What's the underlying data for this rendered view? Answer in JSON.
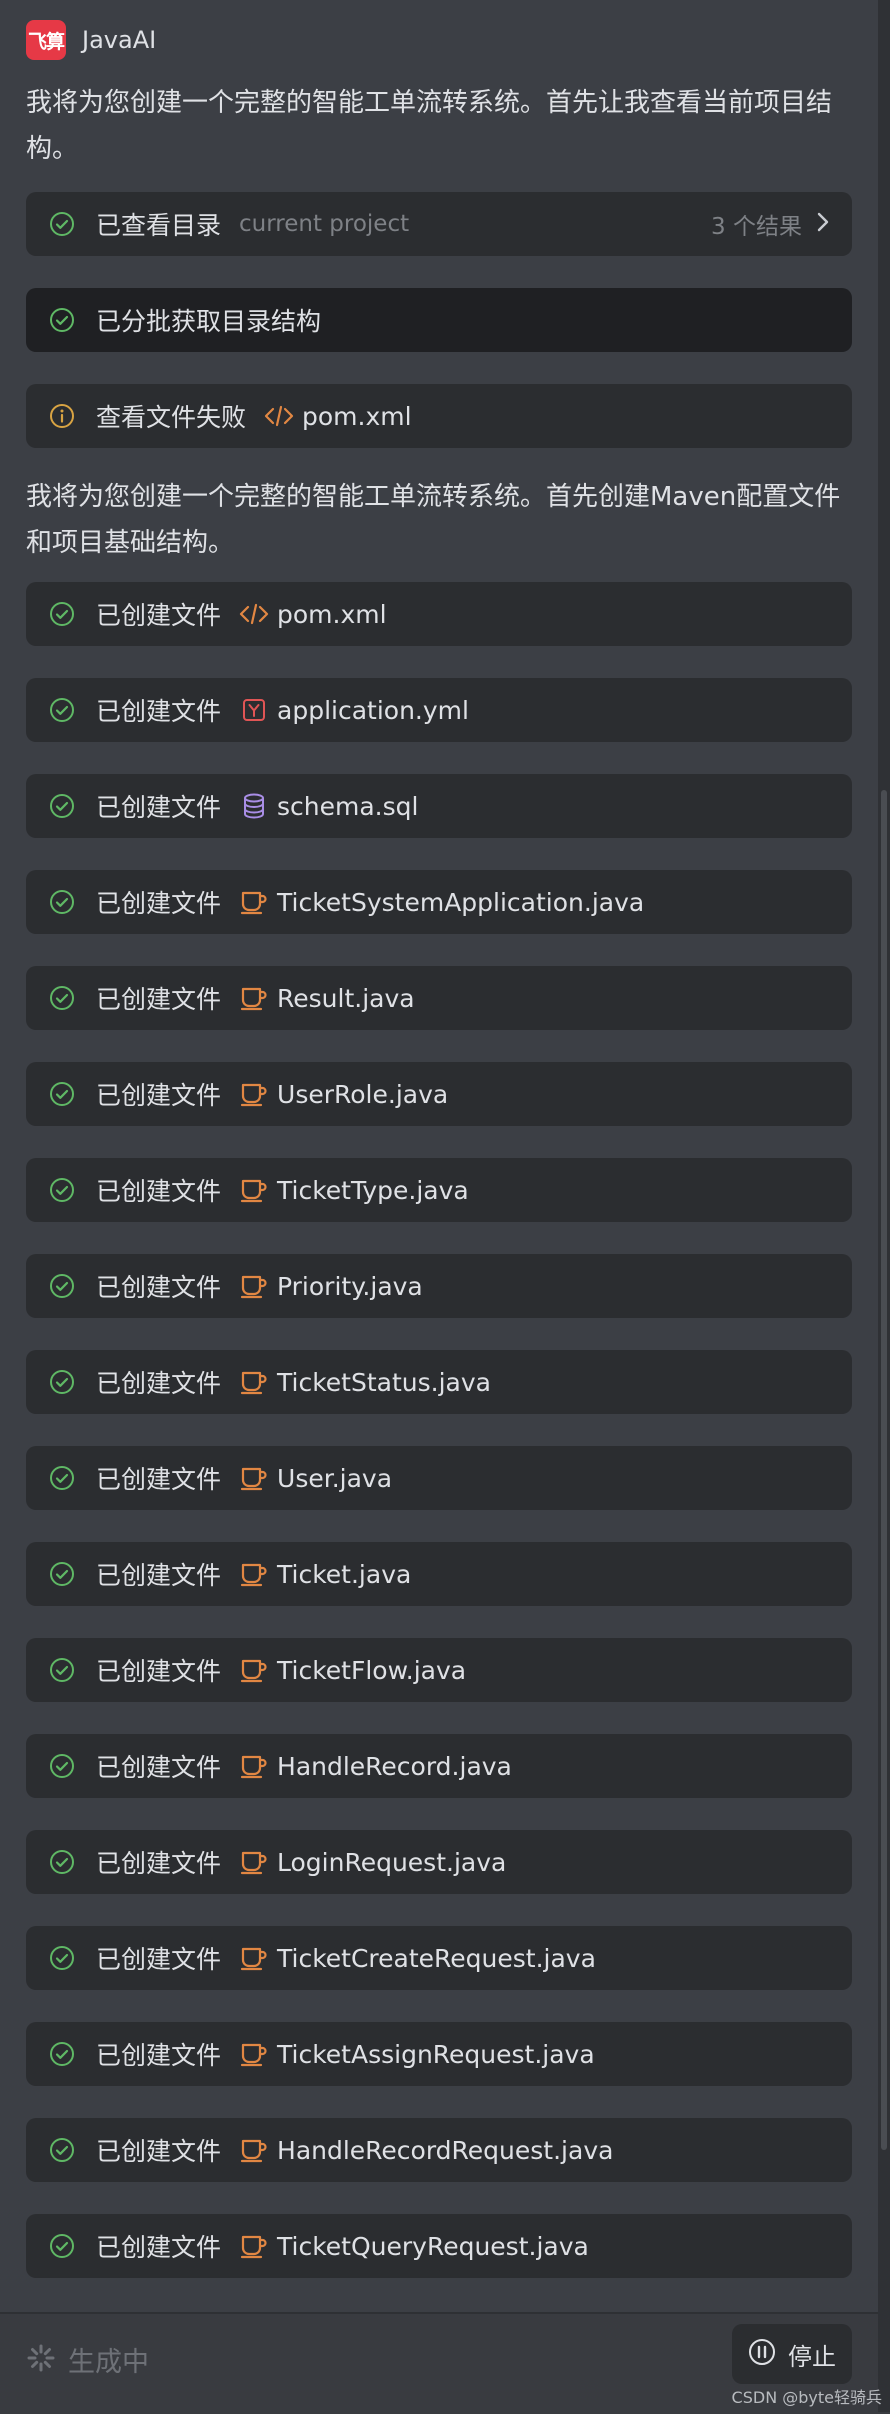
{
  "header": {
    "logo_text": "飞算",
    "app_name": "JavaAI"
  },
  "messages": [
    "我将为您创建一个完整的智能工单流转系统。首先让我查看当前项目结构。",
    "我将为您创建一个完整的智能工单流转系统。首先创建Maven配置文件和项目基础结构。"
  ],
  "steps": {
    "view_dir": {
      "label": "已查看目录",
      "detail": "current project",
      "count": "3 个结果"
    },
    "batch": {
      "label": "已分批获取目录结构"
    },
    "view_fail": {
      "label": "查看文件失败",
      "file": "pom.xml"
    }
  },
  "created_label": "已创建文件",
  "files": [
    {
      "name": "pom.xml",
      "icon": "xml-icon"
    },
    {
      "name": "application.yml",
      "icon": "yaml-icon"
    },
    {
      "name": "schema.sql",
      "icon": "database-icon"
    },
    {
      "name": "TicketSystemApplication.java",
      "icon": "java-icon"
    },
    {
      "name": "Result.java",
      "icon": "java-icon"
    },
    {
      "name": "UserRole.java",
      "icon": "java-icon"
    },
    {
      "name": "TicketType.java",
      "icon": "java-icon"
    },
    {
      "name": "Priority.java",
      "icon": "java-icon"
    },
    {
      "name": "TicketStatus.java",
      "icon": "java-icon"
    },
    {
      "name": "User.java",
      "icon": "java-icon"
    },
    {
      "name": "Ticket.java",
      "icon": "java-icon"
    },
    {
      "name": "TicketFlow.java",
      "icon": "java-icon"
    },
    {
      "name": "HandleRecord.java",
      "icon": "java-icon"
    },
    {
      "name": "LoginRequest.java",
      "icon": "java-icon"
    },
    {
      "name": "TicketCreateRequest.java",
      "icon": "java-icon"
    },
    {
      "name": "TicketAssignRequest.java",
      "icon": "java-icon"
    },
    {
      "name": "HandleRecordRequest.java",
      "icon": "java-icon"
    },
    {
      "name": "TicketQueryRequest.java",
      "icon": "java-icon"
    }
  ],
  "footer": {
    "status": "生成中",
    "stop_label": "停止"
  },
  "watermark": "CSDN @byte轻骑兵",
  "colors": {
    "success": "#5fb865",
    "warning": "#d9a443",
    "file_orange": "#e28743",
    "yaml_red": "#e05555",
    "sql_purple": "#a98ee6",
    "logo": "#e63946"
  }
}
